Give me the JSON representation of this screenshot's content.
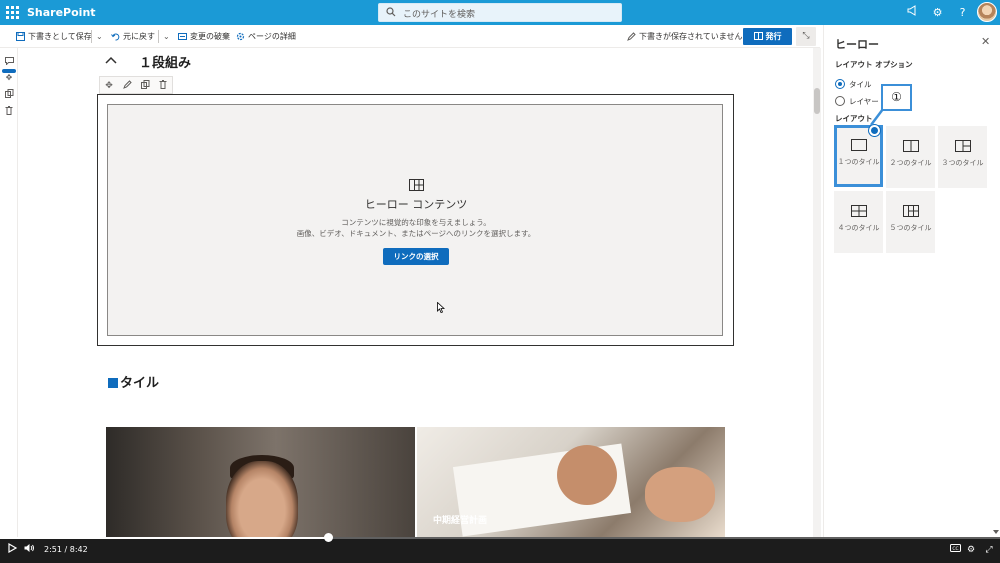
{
  "suite": {
    "brand": "SharePoint",
    "search_placeholder": "このサイトを検索"
  },
  "commandbar": {
    "save_draft": "下書きとして保存",
    "undo": "元に戻す",
    "discard": "変更の破棄",
    "page_details": "ページの詳細",
    "draft_status": "下書きが保存されていません",
    "publish": "発行"
  },
  "canvas": {
    "section_title": "１段組み",
    "hero": {
      "title": "ヒーロー コンテンツ",
      "desc1": "コンテンツに視覚的な印象を与えましょう。",
      "desc2": "画像、ビデオ、ドキュメント、またはページへのリンクを選択します。",
      "button": "リンクの選択"
    },
    "tile_heading": "タイル",
    "tile_caption": "中期経営計画"
  },
  "pane": {
    "title": "ヒーロー",
    "layout_options_label": "レイアウト オプション",
    "radio_tile": "タイル",
    "radio_layer": "レイヤー",
    "layout_label": "レイアウト",
    "options": [
      "１つのタイル",
      "２つのタイル",
      "３つのタイル",
      "４つのタイル",
      "５つのタイル"
    ],
    "selected_index": 0,
    "callout": "①"
  },
  "video": {
    "current": "2:51",
    "separator": "/",
    "total": "8:42",
    "progress": 0.328
  }
}
